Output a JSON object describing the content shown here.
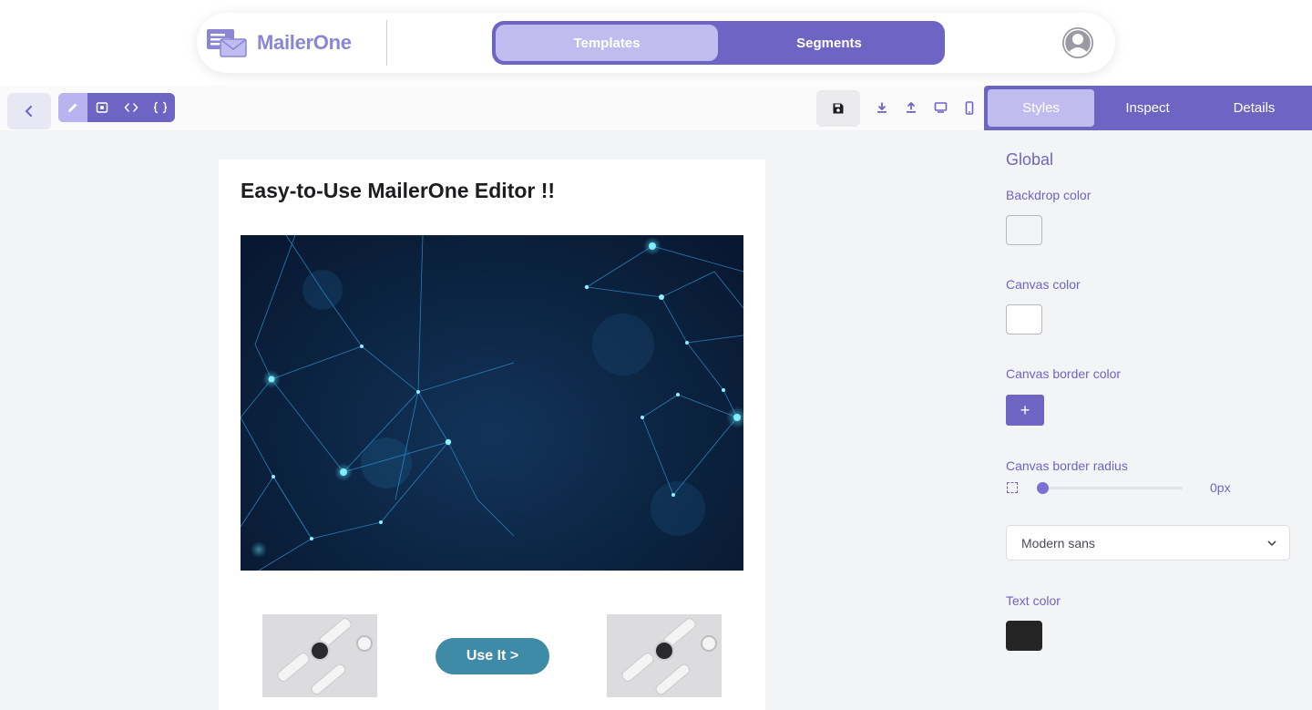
{
  "app": {
    "name": "MailerOne"
  },
  "header": {
    "tabs": [
      {
        "label": "Templates",
        "active": true
      },
      {
        "label": "Segments",
        "active": false
      }
    ],
    "avatar_icon": "user-avatar-icon"
  },
  "toolbar": {
    "back_icon": "chevron-left-icon",
    "modes": [
      "pencil-icon",
      "preview-icon",
      "code-icon",
      "json-braces-icon"
    ],
    "actions": [
      "save-icon",
      "download-icon",
      "upload-icon",
      "desktop-icon",
      "mobile-icon"
    ]
  },
  "email": {
    "title": "Easy-to-Use MailerOne Editor !!",
    "cta_label": "Use It >"
  },
  "panel": {
    "tabs": [
      {
        "label": "Styles",
        "active": true
      },
      {
        "label": "Inspect",
        "active": false
      },
      {
        "label": "Details",
        "active": false
      }
    ],
    "section_title": "Global",
    "backdrop_label": "Backdrop color",
    "backdrop_value": "#F3F4F6",
    "canvas_color_label": "Canvas color",
    "canvas_color_value": "#FFFFFF",
    "border_color_label": "Canvas border color",
    "border_add": "+",
    "border_radius_label": "Canvas border radius",
    "border_radius_value": "0px",
    "font_family": "Modern sans",
    "text_color_label": "Text color",
    "text_color_value": "#242424"
  },
  "colors": {
    "accent": "#6E64C4",
    "accent_light": "#C0BCF0",
    "cta": "#3F8BA7"
  }
}
